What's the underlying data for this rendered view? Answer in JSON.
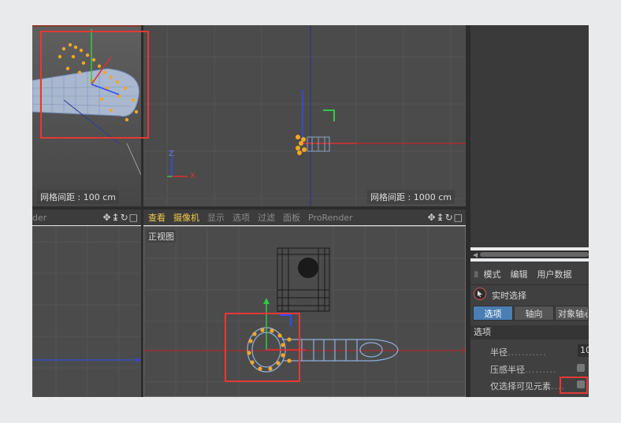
{
  "viewports": {
    "perspective": {
      "grid_spacing": "网格间距 : 100 cm"
    },
    "top": {
      "grid_spacing": "网格间距 : 1000 cm",
      "axis_z": "Z",
      "axis_x": "X"
    },
    "left_bottom": {
      "title_fragment": "der"
    },
    "front": {
      "name": "正视图",
      "menu": [
        "查看",
        "摄像机",
        "显示",
        "选项",
        "过滤",
        "面板",
        "ProRender"
      ]
    }
  },
  "attributes": {
    "tabs": [
      "模式",
      "编辑",
      "用户数据"
    ],
    "tool_name": "实时选择",
    "subtabs": [
      "选项",
      "轴向",
      "对象轴心"
    ],
    "section": "选项",
    "fields": {
      "radius_label": "半径",
      "radius_value": "10",
      "pressure_label": "压感半径",
      "visible_only_label": "仅选择可见元素"
    }
  },
  "colors": {
    "highlight_box": "#e53935",
    "menu_highlight": "#f2c94c",
    "selected_points": "#f5a623",
    "active_tab": "#4a7fb5"
  }
}
